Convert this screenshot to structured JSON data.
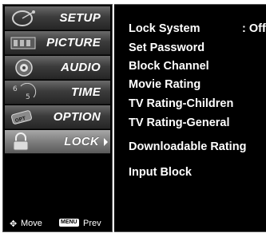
{
  "sidebar": {
    "items": [
      {
        "label": "SETUP",
        "icon": "satellite-dish-icon"
      },
      {
        "label": "PICTURE",
        "icon": "film-reel-icon"
      },
      {
        "label": "AUDIO",
        "icon": "speaker-icon"
      },
      {
        "label": "TIME",
        "icon": "clock-icon"
      },
      {
        "label": "OPTION",
        "icon": "option-icon"
      },
      {
        "label": "LOCK",
        "icon": "padlock-icon",
        "selected": true
      }
    ],
    "hints": {
      "move_label": "Move",
      "prev_key": "MENU",
      "prev_label": "Prev"
    }
  },
  "lock_menu": {
    "options": [
      "Lock System",
      "Set Password",
      "Block Channel",
      "Movie Rating",
      "TV Rating-Children",
      "TV Rating-General",
      "Downloadable Rating",
      "Input Block"
    ],
    "lock_system_value": ": Off"
  },
  "colors": {
    "background": "#000000",
    "text": "#ffffff",
    "selected_item": "#8a8a8a"
  }
}
